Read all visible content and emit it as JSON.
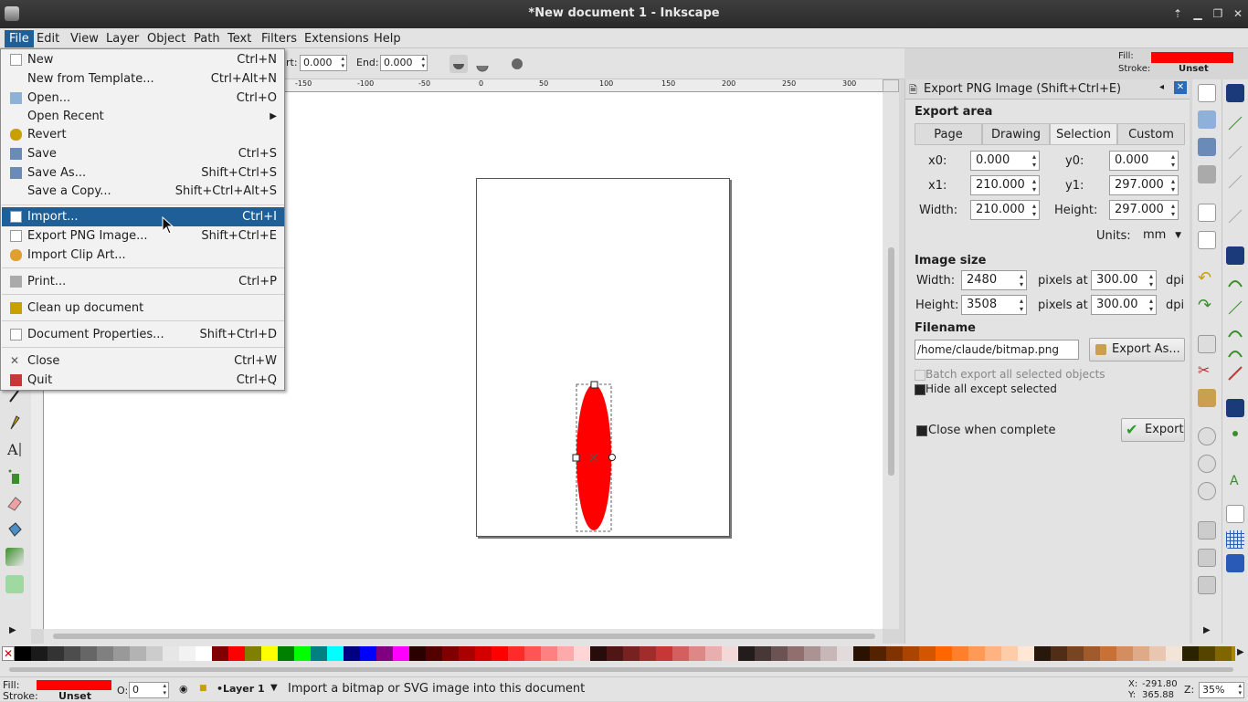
{
  "window": {
    "title": "*New document 1 - Inkscape"
  },
  "menubar": {
    "items": [
      "File",
      "Edit",
      "View",
      "Layer",
      "Object",
      "Path",
      "Text",
      "Filters",
      "Extensions",
      "Help"
    ]
  },
  "file_menu": {
    "items": [
      {
        "label": "New",
        "shortcut": "Ctrl+N"
      },
      {
        "label": "New from Template...",
        "shortcut": "Ctrl+Alt+N"
      },
      {
        "label": "Open...",
        "shortcut": "Ctrl+O"
      },
      {
        "label": "Open Recent",
        "shortcut": ""
      },
      {
        "label": "Revert",
        "shortcut": ""
      },
      {
        "label": "Save",
        "shortcut": "Ctrl+S"
      },
      {
        "label": "Save As...",
        "shortcut": "Shift+Ctrl+S"
      },
      {
        "label": "Save a Copy...",
        "shortcut": "Shift+Ctrl+Alt+S"
      },
      {
        "label": "Import...",
        "shortcut": "Ctrl+I"
      },
      {
        "label": "Export PNG Image...",
        "shortcut": "Shift+Ctrl+E"
      },
      {
        "label": "Import Clip Art...",
        "shortcut": ""
      },
      {
        "label": "Print...",
        "shortcut": "Ctrl+P"
      },
      {
        "label": "Clean up document",
        "shortcut": ""
      },
      {
        "label": "Document Properties...",
        "shortcut": "Shift+Ctrl+D"
      },
      {
        "label": "Close",
        "shortcut": "Ctrl+W"
      },
      {
        "label": "Quit",
        "shortcut": "Ctrl+Q"
      }
    ],
    "open_recent_arrow": "▶"
  },
  "toolctrl": {
    "start_label": "rt:",
    "start_value": "0.000",
    "end_label": "End:",
    "end_value": "0.000"
  },
  "ruler": {
    "top_ticks": [
      "-150",
      "-100",
      "-50",
      "0",
      "50",
      "100",
      "150",
      "200",
      "250",
      "300"
    ]
  },
  "fill_top": {
    "fill_label": "Fill:",
    "stroke_label": "Stroke:",
    "stroke_value": "Unset",
    "fill_color": "#ff0000"
  },
  "export_dialog": {
    "title": "Export PNG Image (Shift+Ctrl+E)",
    "export_area_heading": "Export area",
    "tabs": [
      "Page",
      "Drawing",
      "Selection",
      "Custom"
    ],
    "x0_label": "x0:",
    "x0": "0.000",
    "y0_label": "y0:",
    "y0": "0.000",
    "x1_label": "x1:",
    "x1": "210.000",
    "y1_label": "y1:",
    "y1": "297.000",
    "width_label": "Width:",
    "width": "210.000",
    "height_label": "Height:",
    "height": "297.000",
    "units_label": "Units:",
    "units": "mm",
    "image_size_heading": "Image size",
    "img_width_label": "Width:",
    "img_width": "2480",
    "img_height_label": "Height:",
    "img_height": "3508",
    "pixels_at": "pixels at",
    "dpi_w": "300.00",
    "dpi_h": "300.00",
    "dpi": "dpi",
    "filename_heading": "Filename",
    "filename": "/home/claude/bitmap.png",
    "export_as": "Export As...",
    "batch_label": "Batch export all selected objects",
    "hide_label": "Hide all except selected",
    "close_label": "Close when complete",
    "export_button": "Export"
  },
  "status": {
    "fill_label": "Fill:",
    "stroke_label": "Stroke:",
    "stroke_value": "Unset",
    "opacity_label": "O:",
    "opacity_value": "0",
    "layer": "•Layer 1",
    "message": "Import a bitmap or SVG image into this document",
    "x_label": "X:",
    "x": "-291.80",
    "y_label": "Y:",
    "y": "365.88",
    "zoom_label": "Z:",
    "zoom": "35%",
    "fill_color": "#ff0000"
  },
  "palette": {
    "colors": [
      "#000000",
      "#1a1a1a",
      "#333333",
      "#4d4d4d",
      "#666666",
      "#808080",
      "#999999",
      "#b3b3b3",
      "#cccccc",
      "#e6e6e6",
      "#f2f2f2",
      "#ffffff",
      "#800000",
      "#ff0000",
      "#808000",
      "#ffff00",
      "#008000",
      "#00ff00",
      "#008080",
      "#00ffff",
      "#000080",
      "#0000ff",
      "#800080",
      "#ff00ff",
      "#2b0000",
      "#550000",
      "#800000",
      "#aa0000",
      "#d40000",
      "#ff0000",
      "#ff2a2a",
      "#ff5555",
      "#ff8080",
      "#ffaaaa",
      "#ffd5d5",
      "#280b0b",
      "#501616",
      "#782121",
      "#a02c2c",
      "#c83737",
      "#d35f5f",
      "#de8787",
      "#e9afaf",
      "#f4d7d7",
      "#241c1c",
      "#483737",
      "#6c5353",
      "#916f6f",
      "#ac9393",
      "#c8b7b7",
      "#e3dbdb",
      "#2b1100",
      "#552200",
      "#803300",
      "#aa4400",
      "#d45500",
      "#ff6600",
      "#ff7f2a",
      "#ff9955",
      "#ffb380",
      "#ffccaa",
      "#ffe6d5",
      "#28170b",
      "#502d16",
      "#784421",
      "#a05a2c",
      "#c87137",
      "#d38d5f",
      "#deaa87",
      "#e9c6af",
      "#f4e3d7",
      "#2b2200",
      "#554400",
      "#806600",
      "#aa8800"
    ]
  }
}
